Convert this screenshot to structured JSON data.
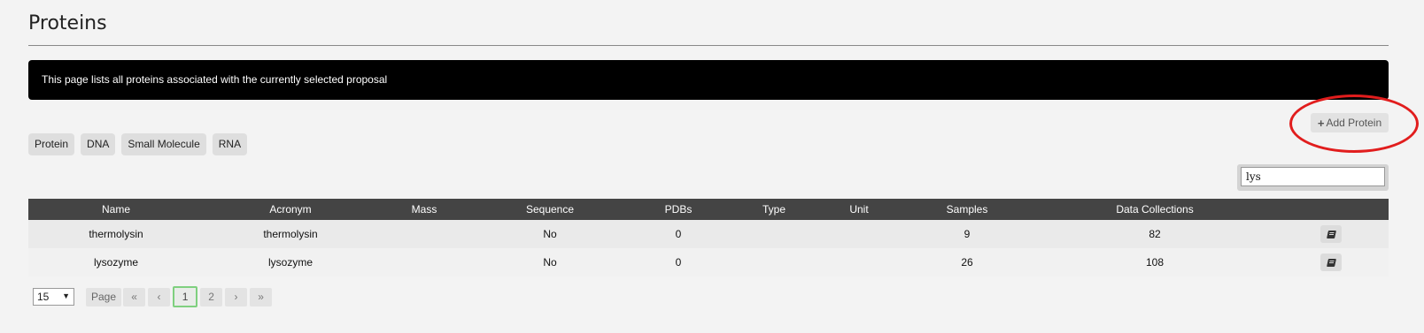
{
  "page": {
    "title": "Proteins",
    "banner": "This page lists all proteins associated with the currently selected proposal"
  },
  "actions": {
    "add_protein": "Add Protein",
    "add_icon": "plus-icon"
  },
  "type_tabs": [
    "Protein",
    "DNA",
    "Small Molecule",
    "RNA"
  ],
  "search": {
    "value": "lys"
  },
  "table": {
    "columns": [
      "Name",
      "Acronym",
      "Mass",
      "Sequence",
      "PDBs",
      "Type",
      "Unit",
      "Samples",
      "Data Collections",
      ""
    ],
    "rows": [
      {
        "name": "thermolysin",
        "acronym": "thermolysin",
        "mass": "",
        "sequence": "No",
        "pdbs": "0",
        "type": "",
        "unit": "",
        "samples": "9",
        "data_collections": "82",
        "action_icon": "book-icon"
      },
      {
        "name": "lysozyme",
        "acronym": "lysozyme",
        "mass": "",
        "sequence": "No",
        "pdbs": "0",
        "type": "",
        "unit": "",
        "samples": "26",
        "data_collections": "108",
        "action_icon": "book-icon"
      }
    ]
  },
  "pagination": {
    "per_page": "15",
    "page_label": "Page",
    "first": "«",
    "prev": "‹",
    "pages": [
      "1",
      "2"
    ],
    "current_page": "1",
    "next": "›",
    "last": "»"
  },
  "colors": {
    "annotation": "#e11d1d",
    "header_bg": "#444444",
    "banner_bg": "#000000",
    "active_page_border": "#7fd07f"
  }
}
